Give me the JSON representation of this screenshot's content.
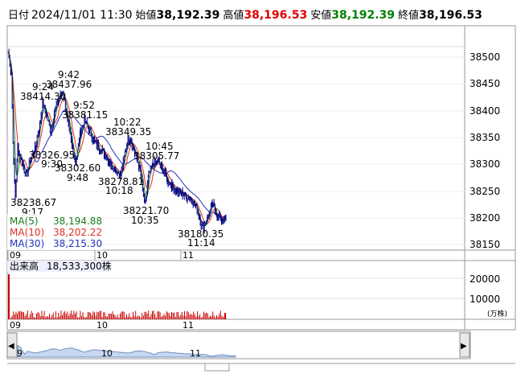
{
  "header": {
    "date_label": "日付",
    "date_value": "2024/11/01 11:30",
    "open_label": "始値",
    "open_value": "38,192.39",
    "high_label": "高値",
    "high_value": "38,196.53",
    "low_label": "安値",
    "low_value": "38,192.39",
    "close_label": "終値",
    "close_value": "38,196.53"
  },
  "colors": {
    "high": "#e00000",
    "low": "#008000",
    "ma5": "#1a7a1a",
    "ma10": "#e03020",
    "ma30": "#2030c0",
    "candle": "#000080",
    "volume": "#cc0000"
  },
  "price_axis_ticks": [
    "38500",
    "38450",
    "38400",
    "38350",
    "38300",
    "38250",
    "38200",
    "38150"
  ],
  "time_axis_labels": [
    "09",
    "10",
    "11"
  ],
  "annotations": [
    {
      "time": "9:42",
      "price": "38437.96"
    },
    {
      "time": "9:24",
      "price": "38414.30"
    },
    {
      "time": "9:52",
      "price": "38381.15"
    },
    {
      "time": "10:22",
      "price": "38349.35"
    },
    {
      "time": "10:45",
      "price": "38305.77"
    },
    {
      "time": "9:30",
      "price": "38326.95"
    },
    {
      "time": "9:48",
      "price": "38302.60"
    },
    {
      "time": "10:18",
      "price": "38278.81"
    },
    {
      "time": "9:17",
      "price": "38238.67"
    },
    {
      "time": "10:35",
      "price": "38221.70"
    },
    {
      "time": "11:14",
      "price": "38180.35"
    }
  ],
  "legend": {
    "ma5_label": "MA(5)",
    "ma5_value": "38,194.88",
    "ma10_label": "MA(10)",
    "ma10_value": "38,202.22",
    "ma30_label": "MA(30)",
    "ma30_value": "38,215.30"
  },
  "volume_panel": {
    "title": "出来高",
    "value": "18,533,300株",
    "ticks": [
      "20000",
      "10000"
    ],
    "unit": "(万株)"
  },
  "navigator": {
    "labels": [
      "09",
      "10",
      "11"
    ],
    "left_arrow": "◀",
    "right_arrow": "▶"
  }
}
